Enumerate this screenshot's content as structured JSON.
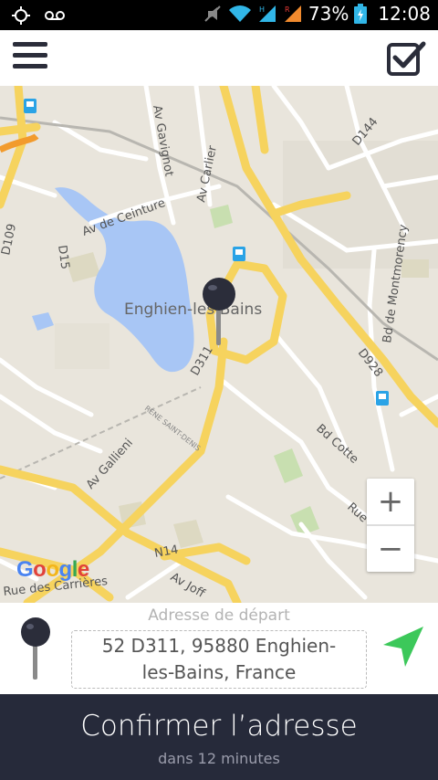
{
  "status": {
    "battery": "73%",
    "time": "12:08"
  },
  "map": {
    "labels": {
      "gavignot": "Av Gavignot",
      "carlier": "Av Carlier",
      "d144": "D144",
      "d109": "D109",
      "ceinture": "Av de Ceinture",
      "d15": "D15",
      "enghien": "Enghien-les-Bains",
      "montmorency": "Bd de Montmorency",
      "d311": "D311",
      "d928": "D928",
      "cotte": "Bd Cotte",
      "gallieni": "Av Gallieni",
      "stdenis": "RENE SAINT-DENIS",
      "rueb": "Rue d Bl",
      "n14": "N14",
      "joff": "Av Joff",
      "carrieres": "Rue des Carrières"
    },
    "zoom_in": "+",
    "zoom_out": "−",
    "google": [
      "G",
      "o",
      "o",
      "g",
      "l",
      "e"
    ]
  },
  "address": {
    "label": "Adresse de départ",
    "value": "52 D311, 95880 Enghien-les-Bains, France"
  },
  "confirm": {
    "title": "Confirmer l’adresse",
    "subtitle": "dans 12 minutes"
  },
  "colors": {
    "bottom_bar": "#262a3a",
    "send_arrow": "#3cc85a",
    "lake": "#a8c6f5",
    "road_major": "#f6d35e"
  }
}
